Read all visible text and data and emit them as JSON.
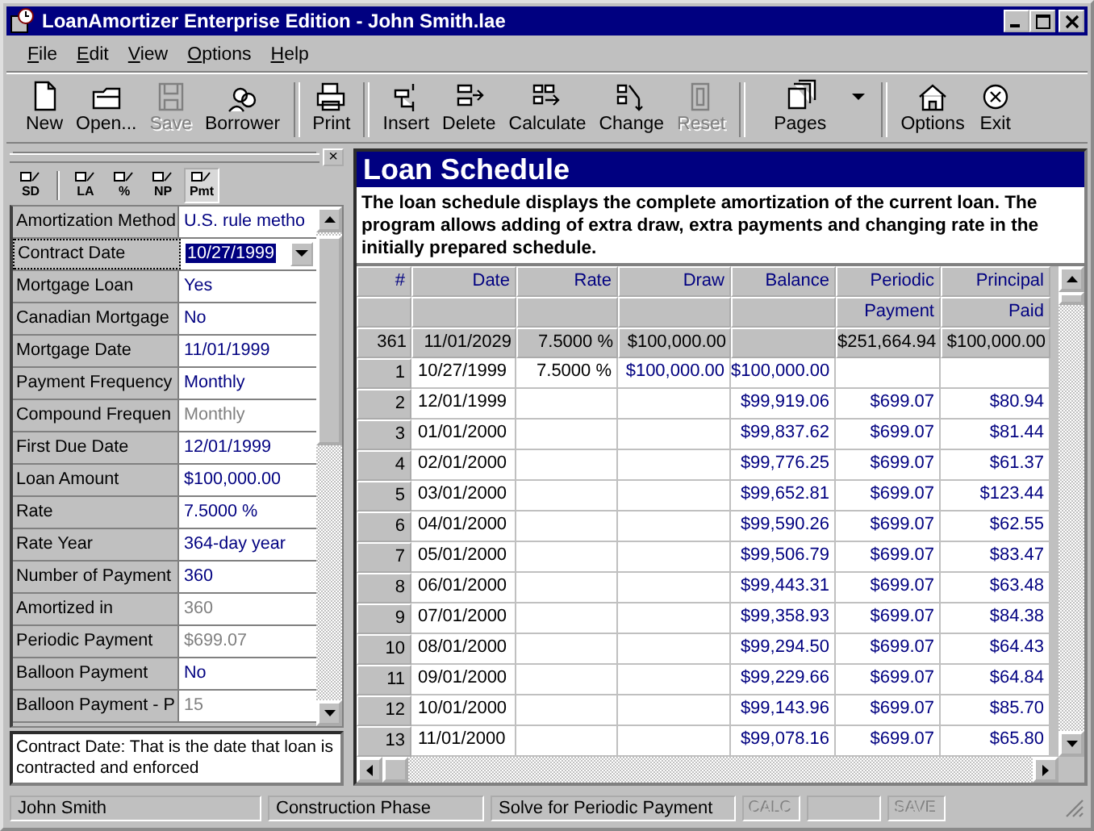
{
  "window": {
    "title": "LoanAmortizer Enterprise Edition - John Smith.lae"
  },
  "menu": [
    {
      "label": "File"
    },
    {
      "label": "Edit"
    },
    {
      "label": "View"
    },
    {
      "label": "Options"
    },
    {
      "label": "Help"
    }
  ],
  "toolbar": [
    [
      {
        "label": "New",
        "disabled": false,
        "dropdown": false
      },
      {
        "label": "Open...",
        "disabled": false,
        "dropdown": false
      },
      {
        "label": "Save",
        "disabled": true,
        "dropdown": false
      },
      {
        "label": "Borrower",
        "disabled": false,
        "dropdown": false
      }
    ],
    [
      {
        "label": "Print",
        "disabled": false,
        "dropdown": false
      }
    ],
    [
      {
        "label": "Insert",
        "disabled": false,
        "dropdown": false
      },
      {
        "label": "Delete",
        "disabled": false,
        "dropdown": false
      },
      {
        "label": "Calculate",
        "disabled": false,
        "dropdown": false
      },
      {
        "label": "Change",
        "disabled": false,
        "dropdown": false
      },
      {
        "label": "Reset",
        "disabled": true,
        "dropdown": false
      }
    ],
    [
      {
        "label": "Pages",
        "disabled": false,
        "dropdown": true
      }
    ],
    [
      {
        "label": "Options",
        "disabled": false,
        "dropdown": false
      },
      {
        "label": "Exit",
        "disabled": false,
        "dropdown": false
      }
    ]
  ],
  "property_panel": {
    "close": "×",
    "tools": [
      {
        "label": "SD",
        "selected": false
      },
      {
        "label": "LA",
        "selected": false
      },
      {
        "label": "%",
        "selected": false
      },
      {
        "label": "NP",
        "selected": false
      },
      {
        "label": "Pmt",
        "selected": true
      }
    ],
    "properties": [
      {
        "label": "Amortization Method",
        "value": "U.S. rule metho",
        "disabled": false,
        "selected": false
      },
      {
        "label": "Contract Date",
        "value": "10/27/1999",
        "disabled": false,
        "selected": true
      },
      {
        "label": "Mortgage Loan",
        "value": "Yes",
        "disabled": false,
        "selected": false
      },
      {
        "label": "Canadian Mortgage",
        "value": "No",
        "disabled": false,
        "selected": false
      },
      {
        "label": "Mortgage Date",
        "value": "11/01/1999",
        "disabled": false,
        "selected": false
      },
      {
        "label": "Payment Frequency",
        "value": "Monthly",
        "disabled": false,
        "selected": false
      },
      {
        "label": "Compound Frequen",
        "value": "Monthly",
        "disabled": true,
        "selected": false
      },
      {
        "label": "First Due Date",
        "value": "12/01/1999",
        "disabled": false,
        "selected": false
      },
      {
        "label": "Loan Amount",
        "value": "$100,000.00",
        "disabled": false,
        "selected": false
      },
      {
        "label": "Rate",
        "value": "7.5000 %",
        "disabled": false,
        "selected": false
      },
      {
        "label": "Rate Year",
        "value": "364-day year",
        "disabled": false,
        "selected": false
      },
      {
        "label": "Number of Payment",
        "value": "360",
        "disabled": false,
        "selected": false
      },
      {
        "label": "Amortized in",
        "value": "360",
        "disabled": true,
        "selected": false
      },
      {
        "label": "Periodic Payment",
        "value": "$699.07",
        "disabled": true,
        "selected": false
      },
      {
        "label": "Balloon Payment",
        "value": "No",
        "disabled": false,
        "selected": false
      },
      {
        "label": "Balloon Payment - P",
        "value": "15",
        "disabled": true,
        "selected": false
      }
    ],
    "description": "Contract Date: That is the date that loan is contracted and enforced"
  },
  "schedule": {
    "title": "Loan Schedule",
    "description": "The loan schedule displays the complete amortization of the current loan. The program allows adding of extra draw, extra payments and changing rate in the initially prepared schedule.",
    "columns": [
      {
        "label": "#"
      },
      {
        "label": "Date"
      },
      {
        "label": "Rate"
      },
      {
        "label": "Draw"
      },
      {
        "label": "Balance"
      },
      {
        "label": "Periodic",
        "label_2": "Payment"
      },
      {
        "label": "Principal",
        "label_2": "Paid"
      }
    ],
    "rows": [
      {
        "kind": "summary",
        "cells": [
          "361",
          "11/01/2029",
          "7.5000 %",
          "$100,000.00",
          null,
          "$251,664.94",
          "$100,000.00"
        ]
      },
      {
        "kind": "data",
        "cells": [
          "1",
          "10/27/1999",
          "7.5000 %",
          "$100,000.00",
          "$100,000.00",
          null,
          null
        ]
      },
      {
        "kind": "data",
        "cells": [
          "2",
          "12/01/1999",
          null,
          null,
          "$99,919.06",
          "$699.07",
          "$80.94"
        ]
      },
      {
        "kind": "data",
        "cells": [
          "3",
          "01/01/2000",
          null,
          null,
          "$99,837.62",
          "$699.07",
          "$81.44"
        ]
      },
      {
        "kind": "data",
        "cells": [
          "4",
          "02/01/2000",
          null,
          null,
          "$99,776.25",
          "$699.07",
          "$61.37"
        ]
      },
      {
        "kind": "data",
        "cells": [
          "5",
          "03/01/2000",
          null,
          null,
          "$99,652.81",
          "$699.07",
          "$123.44"
        ]
      },
      {
        "kind": "data",
        "cells": [
          "6",
          "04/01/2000",
          null,
          null,
          "$99,590.26",
          "$699.07",
          "$62.55"
        ]
      },
      {
        "kind": "data",
        "cells": [
          "7",
          "05/01/2000",
          null,
          null,
          "$99,506.79",
          "$699.07",
          "$83.47"
        ]
      },
      {
        "kind": "data",
        "cells": [
          "8",
          "06/01/2000",
          null,
          null,
          "$99,443.31",
          "$699.07",
          "$63.48"
        ]
      },
      {
        "kind": "data",
        "cells": [
          "9",
          "07/01/2000",
          null,
          null,
          "$99,358.93",
          "$699.07",
          "$84.38"
        ]
      },
      {
        "kind": "data",
        "cells": [
          "10",
          "08/01/2000",
          null,
          null,
          "$99,294.50",
          "$699.07",
          "$64.43"
        ]
      },
      {
        "kind": "data",
        "cells": [
          "11",
          "09/01/2000",
          null,
          null,
          "$99,229.66",
          "$699.07",
          "$64.84"
        ]
      },
      {
        "kind": "data",
        "cells": [
          "12",
          "10/01/2000",
          null,
          null,
          "$99,143.96",
          "$699.07",
          "$85.70"
        ]
      },
      {
        "kind": "data",
        "cells": [
          "13",
          "11/01/2000",
          null,
          null,
          "$99,078.16",
          "$699.07",
          "$65.80"
        ]
      }
    ]
  },
  "status_bar": [
    {
      "kind": "text",
      "text": "John Smith"
    },
    {
      "kind": "text",
      "text": "Construction Phase"
    },
    {
      "kind": "text",
      "text": "Solve for Periodic Payment"
    },
    {
      "kind": "button",
      "text": "CALC",
      "disabled": true
    },
    {
      "kind": "blank"
    },
    {
      "kind": "button",
      "text": "SAVE",
      "disabled": true
    }
  ]
}
